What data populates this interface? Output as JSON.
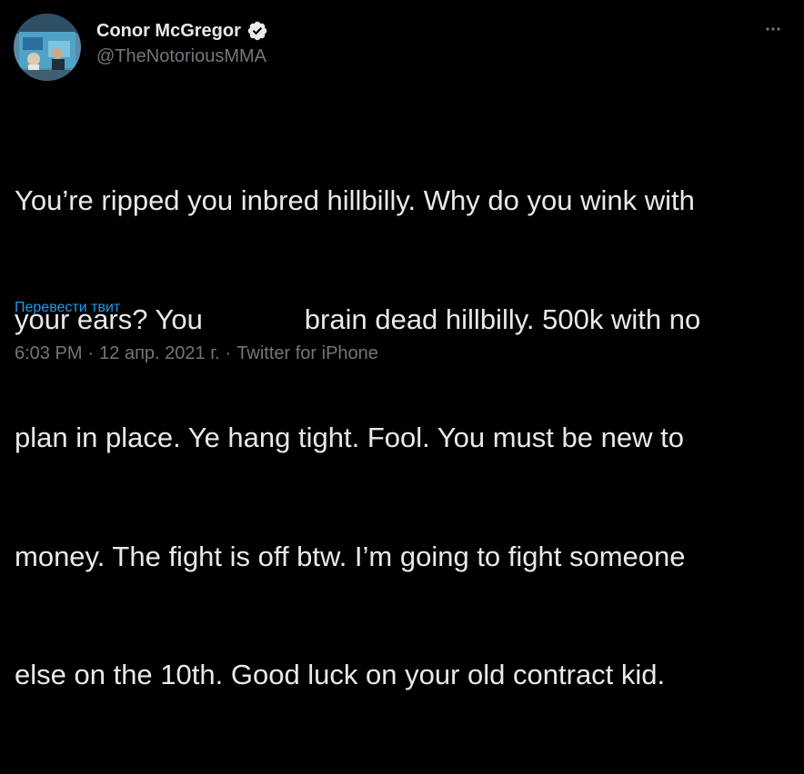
{
  "author": {
    "display_name": "Conor McGregor",
    "handle": "@TheNotoriousMMA",
    "verified": true,
    "avatar_icon": "avatar-photo"
  },
  "tweet": {
    "lines": [
      "You’re ripped you inbred hillbilly. Why do you wink with",
      "your ears? You             brain dead hillbilly. 500k with no",
      "plan in place. Ye hang tight. Fool. You must be new to",
      "money. The fight is off btw. I’m going to fight someone",
      "else on the 10th. Good luck on your old contract kid."
    ],
    "translate_label": "Перевести твит"
  },
  "meta": {
    "time": "6:03 PM",
    "separator": "·",
    "date": "12 апр. 2021 г.",
    "source": "Twitter for iPhone"
  },
  "colors": {
    "background": "#000000",
    "text_primary": "#e7e9ea",
    "text_secondary": "#71767b",
    "link": "#1d9bf0",
    "verified_badge": "#e7e9ea"
  },
  "icons": {
    "more": "more-horizontal-icon",
    "verified": "verified-badge-icon"
  }
}
